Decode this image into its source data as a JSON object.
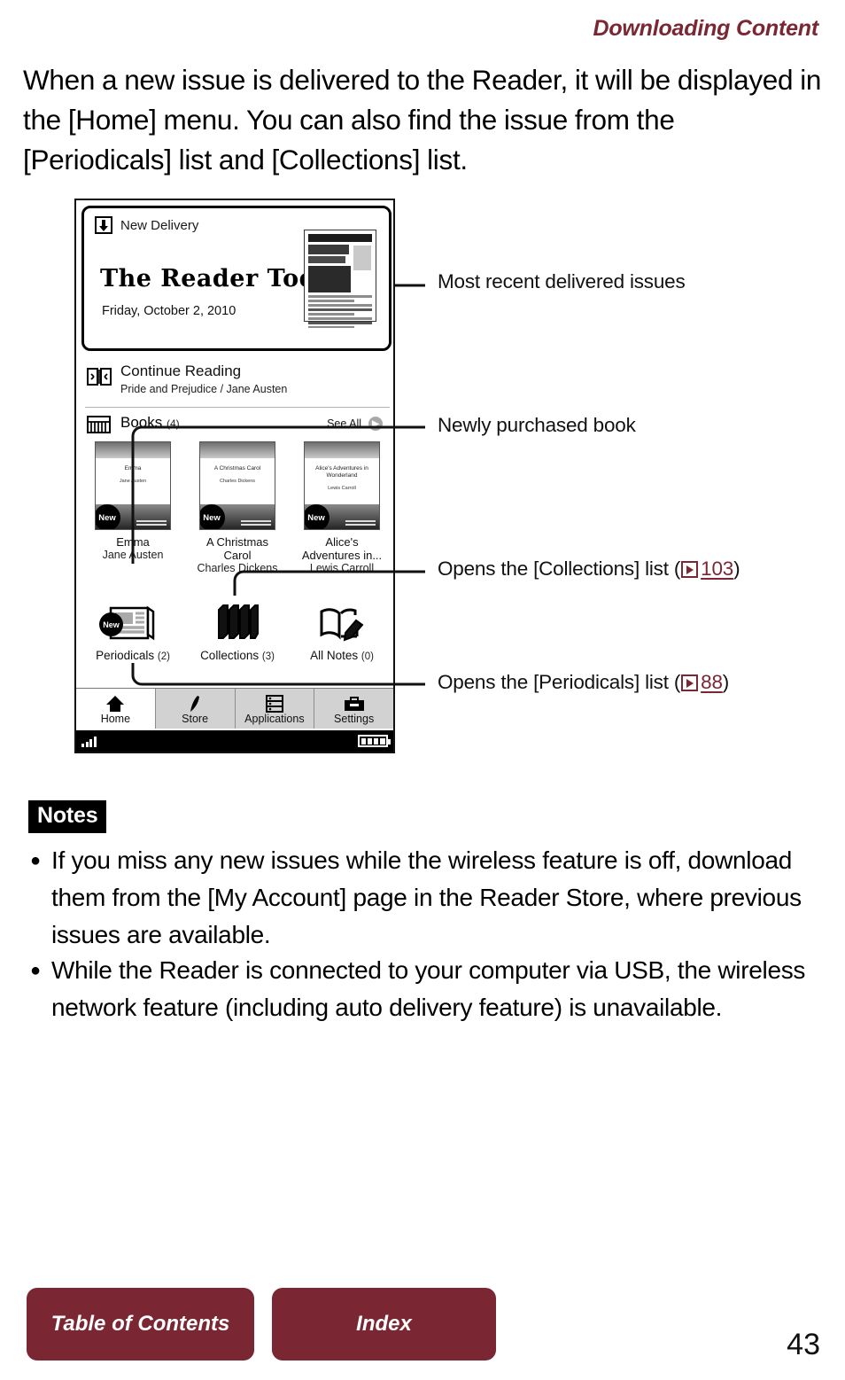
{
  "header": {
    "chapter_title": "Downloading Content"
  },
  "intro": "When a new issue is delivered to the Reader, it will be displayed in the [Home] menu. You can also find the issue from the [Periodicals] list and [Collections] list.",
  "device": {
    "new_delivery": {
      "header_label": "New Delivery",
      "publication_title": "The Reader Today",
      "date": "Friday, October 2, 2010"
    },
    "continue_reading": {
      "label": "Continue Reading",
      "subtitle": "Pride and Prejudice / Jane Austen"
    },
    "books_section": {
      "label": "Books",
      "count": "(4)",
      "see_all": "See All"
    },
    "books": [
      {
        "title": "Emma",
        "author": "Jane Austen",
        "cover_title": "Emma",
        "cover_author": "Jane Austen",
        "badge": "New"
      },
      {
        "title": "A Christmas Carol",
        "author": "Charles Dickens",
        "cover_title": "A Christmas Carol",
        "cover_author": "Charles Dickens",
        "badge": "New"
      },
      {
        "title": "Alice's Adventures in...",
        "author": "Lewis Carroll",
        "cover_title": "Alice's Adventures in Wonderland",
        "cover_author": "Lewis Carroll",
        "badge": "New"
      }
    ],
    "tiles": [
      {
        "label": "Periodicals",
        "count": "(2)",
        "badge": "New"
      },
      {
        "label": "Collections",
        "count": "(3)",
        "badge": ""
      },
      {
        "label": "All Notes",
        "count": "(0)",
        "badge": ""
      }
    ],
    "nav": [
      {
        "label": "Home"
      },
      {
        "label": "Store"
      },
      {
        "label": "Applications"
      },
      {
        "label": "Settings"
      }
    ]
  },
  "callouts": [
    {
      "text": "Most recent delivered issues"
    },
    {
      "text": "Newly purchased book"
    },
    {
      "prefix": "Opens the [Collections] list (",
      "page": "103",
      "suffix": ")"
    },
    {
      "prefix": "Opens the [Periodicals] list (",
      "page": "88",
      "suffix": ")"
    }
  ],
  "notes": {
    "tag": "Notes",
    "items": [
      "If you miss any new issues while the wireless feature is off, download them from the [My Account] page in the Reader Store, where previous issues are available.",
      "While the Reader is connected to your computer via USB, the wireless network feature (including auto delivery feature) is unavailable."
    ],
    "bullet": "●"
  },
  "footer": {
    "toc_label": "Table of Contents",
    "index_label": "Index",
    "page_number": "43"
  },
  "colors": {
    "accent": "#7B2633",
    "text": "#111111"
  }
}
